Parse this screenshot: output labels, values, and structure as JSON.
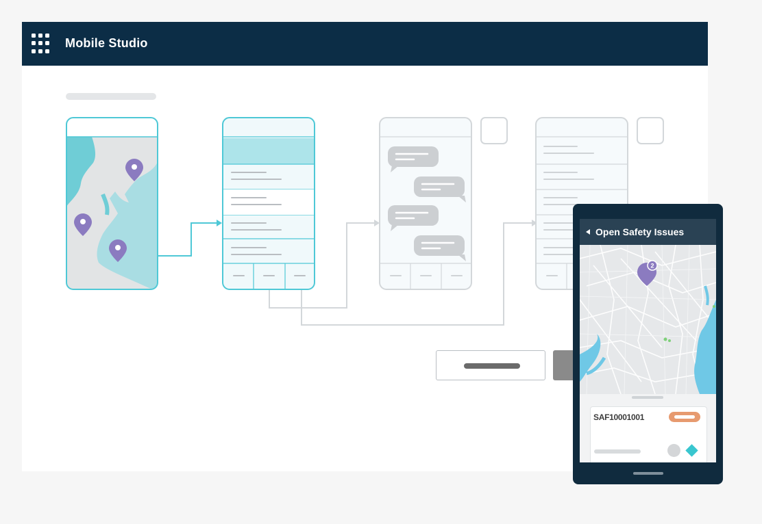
{
  "app": {
    "title": "Mobile Studio"
  },
  "icons": {
    "menu": "grid-menu-icon",
    "back": "back-arrow-icon",
    "map_marker": "map-pin-icon",
    "status": "diamond-icon"
  },
  "colors": {
    "header": "#0c2d46",
    "accent_teal": "#4ec8d6",
    "pin_purple": "#8b7bc0",
    "badge_orange": "#e79a6f",
    "faded_gray": "#cfd4d8"
  },
  "phone": {
    "header_title": "Open Safety Issues",
    "map_badge_count": "2",
    "issue": {
      "id": "SAF10001001"
    }
  }
}
